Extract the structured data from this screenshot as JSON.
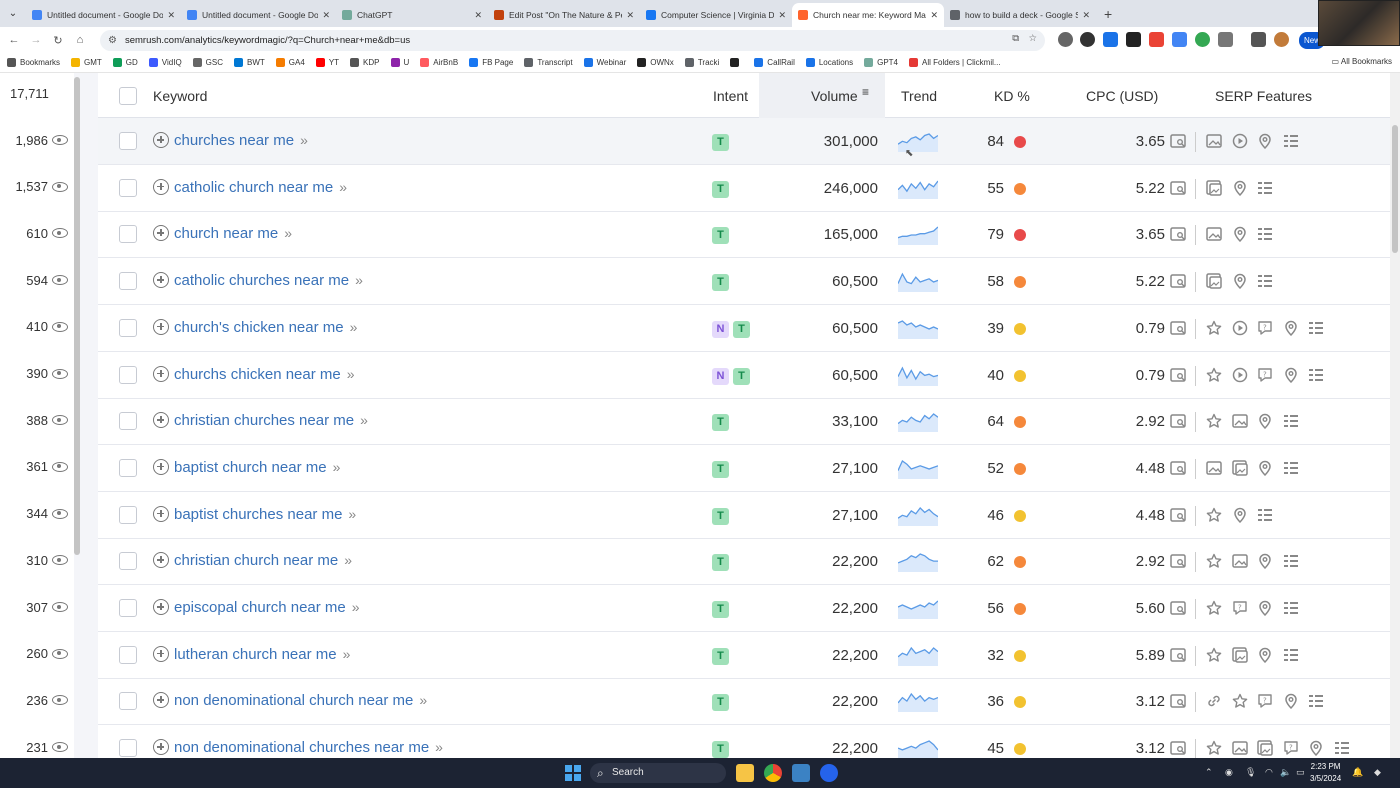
{
  "browser": {
    "tabs": [
      {
        "title": "Untitled document - Google Do",
        "color": "#4285f4",
        "active": false
      },
      {
        "title": "Untitled document - Google Do",
        "color": "#4285f4",
        "active": false
      },
      {
        "title": "ChatGPT",
        "color": "#74aa9c",
        "active": false
      },
      {
        "title": "Edit Post \"On The Nature & Pe",
        "color": "#c2410c",
        "active": false
      },
      {
        "title": "Computer Science | Virginia De",
        "color": "#1877f2",
        "active": false
      },
      {
        "title": "Church near me: Keyword Magi",
        "color": "#ff642d",
        "active": true
      },
      {
        "title": "how to build a deck - Google S",
        "color": "#5f6368",
        "active": false
      }
    ],
    "url": "semrush.com/analytics/keywordmagic/?q=Church+near+me&db=us",
    "new_label": "New",
    "bookmarks": [
      {
        "label": "Bookmarks",
        "color": "#555"
      },
      {
        "label": "GMT",
        "color": "#f4b400"
      },
      {
        "label": "GD",
        "color": "#0f9d58"
      },
      {
        "label": "VidIQ",
        "color": "#3d5afe"
      },
      {
        "label": "GSC",
        "color": "#666"
      },
      {
        "label": "BWT",
        "color": "#0078d4"
      },
      {
        "label": "GA4",
        "color": "#f57c00"
      },
      {
        "label": "YT",
        "color": "#ff0000"
      },
      {
        "label": "KDP",
        "color": "#555"
      },
      {
        "label": "U",
        "color": "#8e24aa"
      },
      {
        "label": "AirBnB",
        "color": "#ff5a5f"
      },
      {
        "label": "FB Page",
        "color": "#1877f2"
      },
      {
        "label": "Transcript",
        "color": "#5f6368"
      },
      {
        "label": "Webinar",
        "color": "#1a73e8"
      },
      {
        "label": "OWNx",
        "color": "#222"
      },
      {
        "label": "Tracki",
        "color": "#5f6368"
      },
      {
        "label": "",
        "color": "#222"
      },
      {
        "label": "CallRail",
        "color": "#1a73e8"
      },
      {
        "label": "Locations",
        "color": "#1a73e8"
      },
      {
        "label": "GPT4",
        "color": "#74aa9c"
      },
      {
        "label": "All Folders | Clickmil...",
        "color": "#e53935"
      }
    ],
    "all_bookmarks": "All Bookmarks"
  },
  "left": {
    "total": "17,711",
    "counts": [
      "1,986",
      "1,537",
      "610",
      "594",
      "410",
      "390",
      "388",
      "361",
      "344",
      "310",
      "307",
      "260",
      "236",
      "231"
    ]
  },
  "table": {
    "headers": {
      "keyword": "Keyword",
      "intent": "Intent",
      "volume": "Volume",
      "trend": "Trend",
      "kd": "KD %",
      "cpc": "CPC (USD)",
      "serp": "SERP Features"
    },
    "rows": [
      {
        "keyword": "churches near me",
        "intents": [
          "T"
        ],
        "volume": "301,000",
        "trend": [
          6,
          8,
          7,
          10,
          11,
          9,
          12,
          13,
          10,
          12
        ],
        "kd": "84",
        "kd_color": "#e84a4a",
        "cpc": "3.65",
        "serp": [
          "image",
          "video",
          "pin",
          "list"
        ]
      },
      {
        "keyword": "catholic church near me",
        "intents": [
          "T"
        ],
        "volume": "246,000",
        "trend": [
          8,
          11,
          7,
          12,
          9,
          13,
          8,
          12,
          10,
          14
        ],
        "kd": "55",
        "kd_color": "#f5883b",
        "cpc": "5.22",
        "serp": [
          "image2",
          "pin",
          "list"
        ]
      },
      {
        "keyword": "church near me",
        "intents": [
          "T"
        ],
        "volume": "165,000",
        "trend": [
          6,
          7,
          7,
          8,
          8,
          9,
          9,
          10,
          11,
          14
        ],
        "kd": "79",
        "kd_color": "#e84a4a",
        "cpc": "3.65",
        "serp": [
          "image",
          "pin",
          "list"
        ]
      },
      {
        "keyword": "catholic churches near me",
        "intents": [
          "T"
        ],
        "volume": "60,500",
        "trend": [
          8,
          14,
          9,
          8,
          12,
          9,
          10,
          11,
          9,
          10
        ],
        "kd": "58",
        "kd_color": "#f5883b",
        "cpc": "5.22",
        "serp": [
          "image2",
          "pin",
          "list"
        ]
      },
      {
        "keyword": "church's chicken near me",
        "intents": [
          "N",
          "T"
        ],
        "volume": "60,500",
        "trend": [
          12,
          13,
          11,
          12,
          10,
          11,
          10,
          9,
          10,
          9
        ],
        "kd": "39",
        "kd_color": "#f2c230",
        "cpc": "0.79",
        "serp": [
          "star",
          "video",
          "faq",
          "pin",
          "list"
        ]
      },
      {
        "keyword": "churchs chicken near me",
        "intents": [
          "N",
          "T"
        ],
        "volume": "60,500",
        "trend": [
          8,
          15,
          7,
          13,
          6,
          12,
          9,
          10,
          8,
          9
        ],
        "kd": "40",
        "kd_color": "#f2c230",
        "cpc": "0.79",
        "serp": [
          "star",
          "video",
          "faq",
          "pin",
          "list"
        ]
      },
      {
        "keyword": "christian churches near me",
        "intents": [
          "T"
        ],
        "volume": "33,100",
        "trend": [
          8,
          10,
          9,
          12,
          10,
          9,
          13,
          11,
          14,
          12
        ],
        "kd": "64",
        "kd_color": "#f5883b",
        "cpc": "2.92",
        "serp": [
          "star",
          "image",
          "pin",
          "list"
        ]
      },
      {
        "keyword": "baptist church near me",
        "intents": [
          "T"
        ],
        "volume": "27,100",
        "trend": [
          8,
          14,
          12,
          9,
          10,
          11,
          10,
          9,
          10,
          11
        ],
        "kd": "52",
        "kd_color": "#f5883b",
        "cpc": "4.48",
        "serp": [
          "image",
          "image2",
          "pin",
          "list"
        ]
      },
      {
        "keyword": "baptist churches near me",
        "intents": [
          "T"
        ],
        "volume": "27,100",
        "trend": [
          7,
          9,
          8,
          12,
          10,
          14,
          11,
          13,
          10,
          8
        ],
        "kd": "46",
        "kd_color": "#f2c230",
        "cpc": "4.48",
        "serp": [
          "star",
          "pin",
          "list"
        ]
      },
      {
        "keyword": "christian church near me",
        "intents": [
          "T"
        ],
        "volume": "22,200",
        "trend": [
          9,
          10,
          11,
          13,
          12,
          14,
          13,
          11,
          10,
          10
        ],
        "kd": "62",
        "kd_color": "#f5883b",
        "cpc": "2.92",
        "serp": [
          "star",
          "image",
          "pin",
          "list"
        ]
      },
      {
        "keyword": "episcopal church near me",
        "intents": [
          "T"
        ],
        "volume": "22,200",
        "trend": [
          10,
          11,
          10,
          9,
          10,
          11,
          10,
          12,
          11,
          13
        ],
        "kd": "56",
        "kd_color": "#f5883b",
        "cpc": "5.60",
        "serp": [
          "star",
          "faq",
          "pin",
          "list"
        ]
      },
      {
        "keyword": "lutheran church near me",
        "intents": [
          "T"
        ],
        "volume": "22,200",
        "trend": [
          8,
          10,
          9,
          13,
          10,
          11,
          12,
          10,
          13,
          11
        ],
        "kd": "32",
        "kd_color": "#f2c230",
        "cpc": "5.89",
        "serp": [
          "star",
          "image2",
          "pin",
          "list"
        ]
      },
      {
        "keyword": "non denominational church near me",
        "intents": [
          "T"
        ],
        "volume": "22,200",
        "trend": [
          9,
          12,
          10,
          14,
          11,
          13,
          10,
          12,
          11,
          12
        ],
        "kd": "36",
        "kd_color": "#f2c230",
        "cpc": "3.12",
        "serp": [
          "link",
          "star",
          "faq",
          "pin",
          "list"
        ]
      },
      {
        "keyword": "non denominational churches near me",
        "intents": [
          "T"
        ],
        "volume": "22,200",
        "trend": [
          10,
          9,
          10,
          11,
          10,
          12,
          13,
          14,
          12,
          9
        ],
        "kd": "45",
        "kd_color": "#f2c230",
        "cpc": "3.12",
        "serp": [
          "star",
          "image",
          "image2",
          "faq",
          "pin",
          "list"
        ]
      }
    ]
  },
  "taskbar": {
    "search_label": "Search",
    "time": "2:23 PM",
    "date": "3/5/2024"
  }
}
